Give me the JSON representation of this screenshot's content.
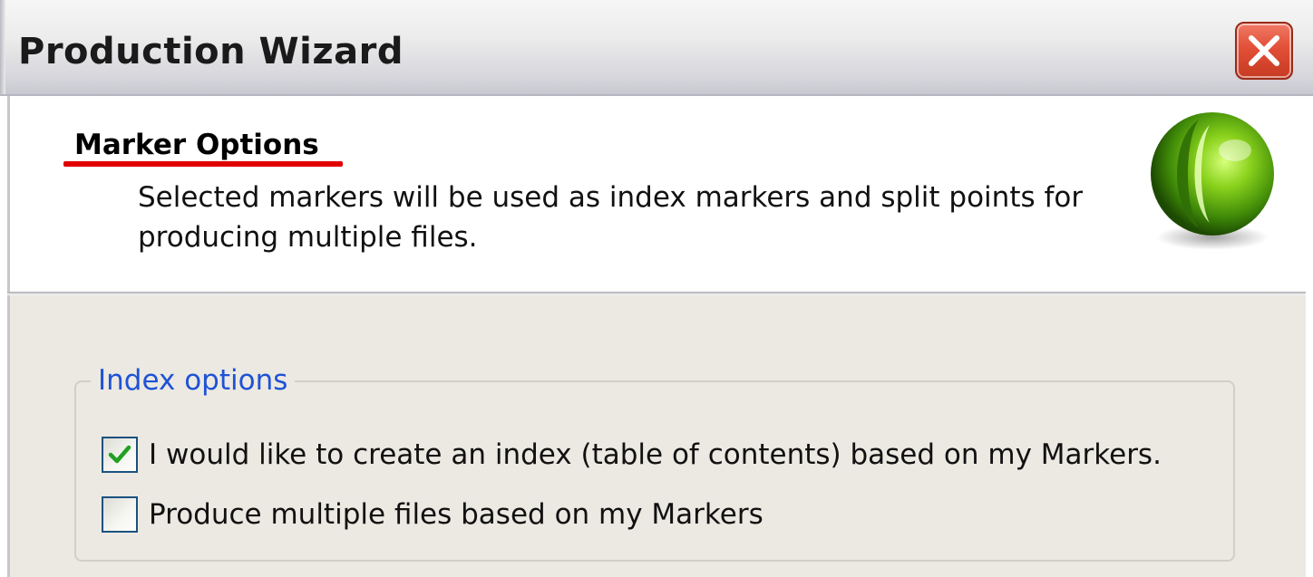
{
  "window": {
    "title": "Production Wizard",
    "close_label": "close"
  },
  "header": {
    "title": "Marker Options",
    "description": "Selected markers will be used as index markers and split points for producing multiple files.",
    "logo_icon": "green-sphere-icon"
  },
  "index_options": {
    "legend": "Index options",
    "options": [
      {
        "label": "I would like to create an index (table of contents) based on my Markers.",
        "checked": true
      },
      {
        "label": "Produce multiple files based on my Markers",
        "checked": false
      }
    ]
  },
  "colors": {
    "legend_text": "#1f52d6",
    "underline": "#e00000",
    "checkmark": "#21a121",
    "close_button": "#e24f37"
  }
}
